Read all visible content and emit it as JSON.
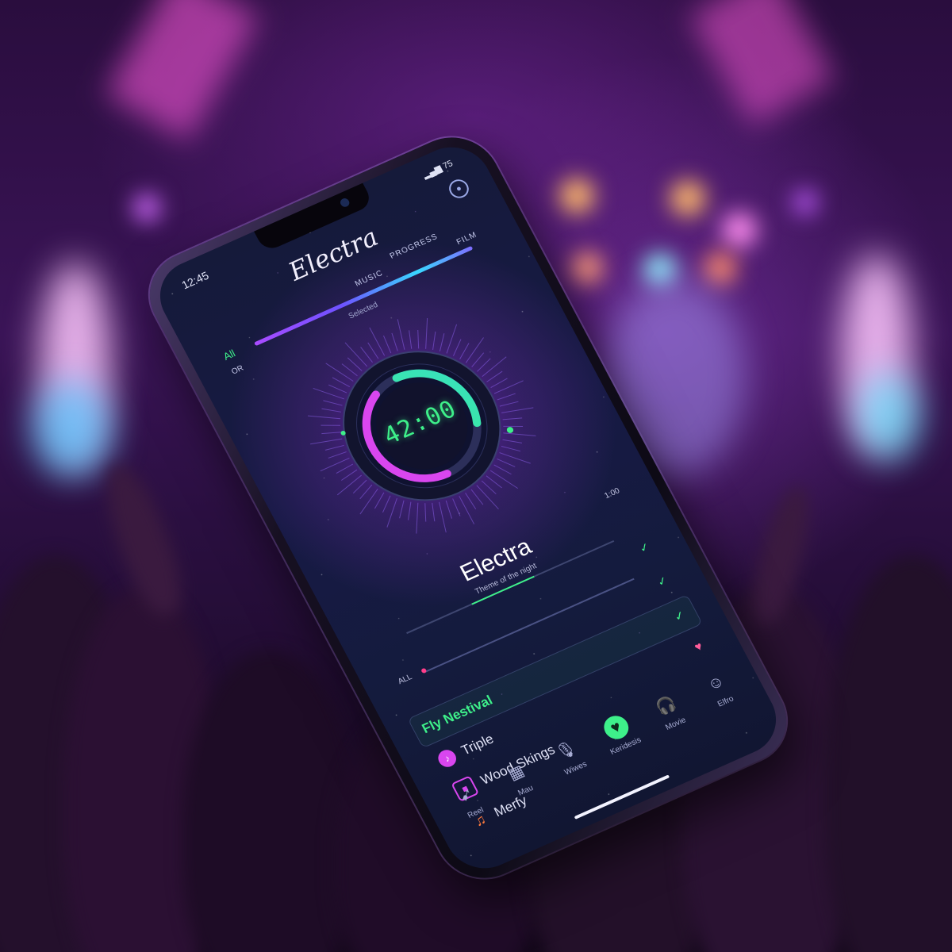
{
  "status": {
    "time": "12:45",
    "icons": "75"
  },
  "app": {
    "title": "Electra"
  },
  "top_tabs": [
    "MUSIC",
    "PROGRESS",
    "FILM"
  ],
  "tags": {
    "left_a": "All",
    "left_b": "OR",
    "center": "Selected"
  },
  "dial": {
    "time": "42:00",
    "progress": 0.62
  },
  "track": {
    "title": "Electra",
    "subtitle": "Theme of the night",
    "time": "1:00",
    "progress": 0.35
  },
  "seek": {
    "label": "ALL",
    "position": 0.02
  },
  "list": [
    {
      "label": "Fly Nestival",
      "icon": "music-note-icon",
      "active": true,
      "right": "check-icon"
    },
    {
      "label": "Triple",
      "icon": "sound-icon",
      "active": false,
      "right": "heart-icon"
    },
    {
      "label": "Wood Skings",
      "icon": "stop-icon",
      "active": false,
      "right": ""
    },
    {
      "label": "Merfy",
      "icon": "music-note-icon",
      "active": false,
      "right": ""
    }
  ],
  "nav": [
    {
      "label": "Reel",
      "icon": "rocket-icon"
    },
    {
      "label": "Mau",
      "icon": "calendar-icon"
    },
    {
      "label": "Wiwes",
      "icon": "mic-icon"
    },
    {
      "label": "Keridesis",
      "icon": "heart-icon",
      "active": true
    },
    {
      "label": "Movie",
      "icon": "headphones-icon"
    },
    {
      "label": "Elfro",
      "icon": "profile-icon"
    }
  ],
  "colors": {
    "accent": "#3ef08a",
    "magenta": "#d946ef",
    "purple": "#7c3aed",
    "background": "#151a3a"
  }
}
